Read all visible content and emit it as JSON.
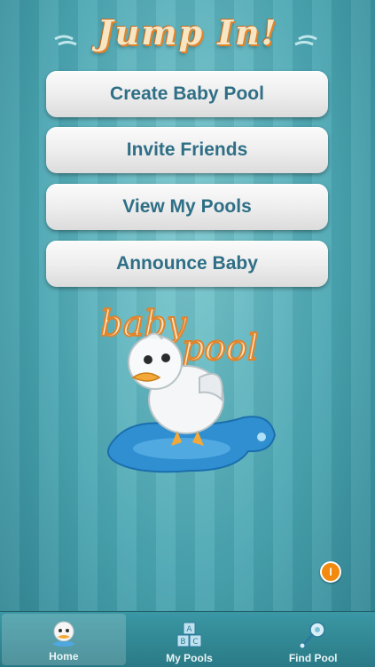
{
  "header": {
    "title": "Jump In!"
  },
  "menu": {
    "create_pool": "Create Baby Pool",
    "invite_friends": "Invite Friends",
    "view_pools": "View My Pools",
    "announce_baby": "Announce Baby"
  },
  "logo": {
    "line1": "baby",
    "line2": "pool"
  },
  "info": {
    "label": "I"
  },
  "tabs": [
    {
      "label": "Home",
      "icon": "duck-icon",
      "active": true
    },
    {
      "label": "My Pools",
      "icon": "blocks-icon",
      "active": false
    },
    {
      "label": "Find Pool",
      "icon": "rattle-icon",
      "active": false
    }
  ],
  "colors": {
    "accent": "#f28a10",
    "button_text": "#2f6f86",
    "background": "#4aa6b2"
  }
}
